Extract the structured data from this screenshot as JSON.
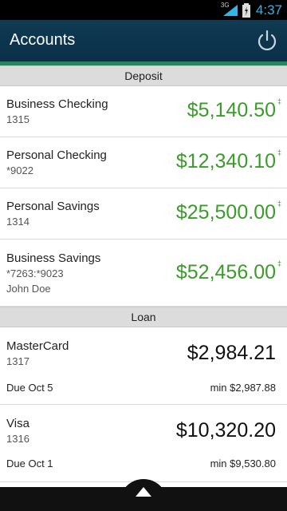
{
  "status": {
    "network": "3G",
    "time": "4:37"
  },
  "appbar": {
    "title": "Accounts",
    "power_icon": "power-icon"
  },
  "deposit": {
    "header": "Deposit",
    "accounts": [
      {
        "name": "Business Checking",
        "sub1": "1315",
        "sub2": "",
        "amount": "$5,140.50",
        "marker": "‡"
      },
      {
        "name": "Personal Checking",
        "sub1": "*9022",
        "sub2": "",
        "amount": "$12,340.10",
        "marker": "‡"
      },
      {
        "name": "Personal Savings",
        "sub1": "1314",
        "sub2": "",
        "amount": "$25,500.00",
        "marker": "‡"
      },
      {
        "name": "Business Savings",
        "sub1": "*7263:*9023",
        "sub2": "John Doe",
        "amount": "$52,456.00",
        "marker": "‡"
      }
    ]
  },
  "loan": {
    "header": "Loan",
    "accounts": [
      {
        "name": "MasterCard",
        "sub1": "1317",
        "amount": "$2,984.21",
        "due": "Due Oct 5",
        "min": "min $2,987.88"
      },
      {
        "name": "Visa",
        "sub1": "1316",
        "amount": "$10,320.20",
        "due": "Due Oct 1",
        "min": "min $9,530.80"
      }
    ]
  },
  "colors": {
    "appbar": "#0f3b53",
    "accent": "#1f8a5d",
    "deposit_amount": "#3a9c2a",
    "clock": "#33b5e5"
  }
}
